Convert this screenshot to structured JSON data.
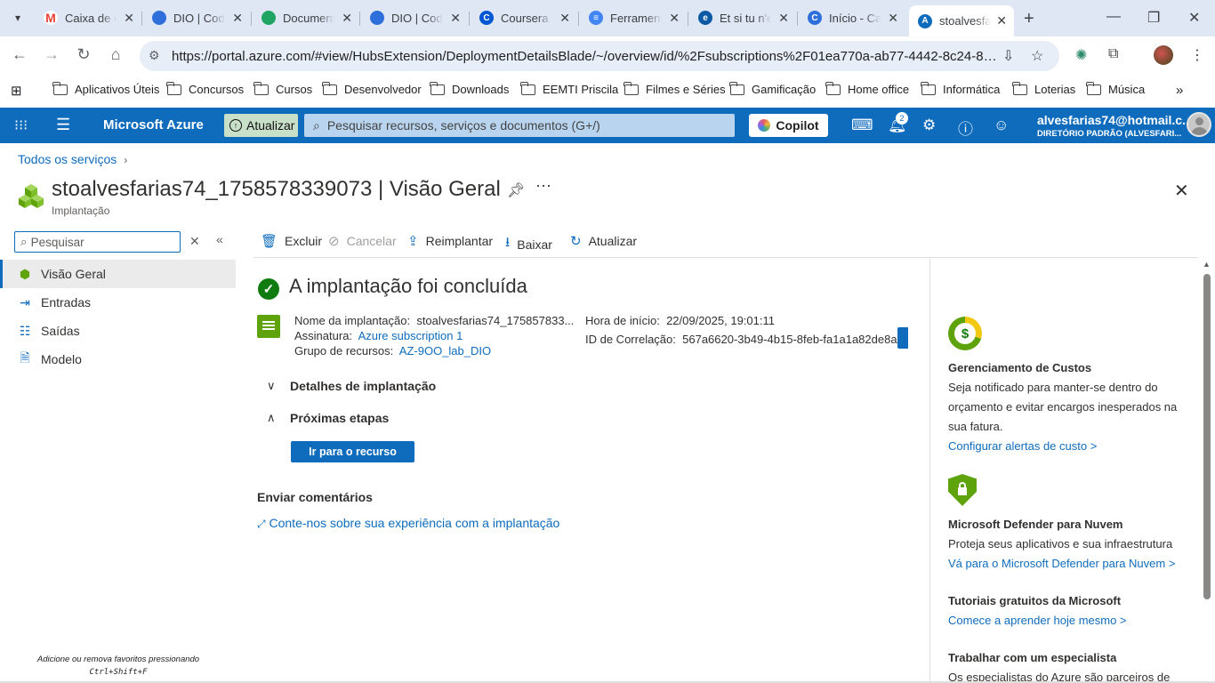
{
  "browser": {
    "tabs": [
      {
        "title": "Caixa de e",
        "icon": "gmail-icon",
        "color": "#ea4335",
        "glyph": "M"
      },
      {
        "title": "DIO | Codi",
        "icon": "dio-icon",
        "color": "#2f6fdc",
        "glyph": ""
      },
      {
        "title": "Documento",
        "icon": "google-drive-icon",
        "color": "#1fa463",
        "glyph": ""
      },
      {
        "title": "DIO | Codi",
        "icon": "dio-icon",
        "color": "#2f6fdc",
        "glyph": ""
      },
      {
        "title": "Coursera |",
        "icon": "coursera-icon",
        "color": "#0056d2",
        "glyph": "C"
      },
      {
        "title": "Ferramenta",
        "icon": "google-docs-icon",
        "color": "#4285f4",
        "glyph": "≡"
      },
      {
        "title": "Et si tu n'e",
        "icon": "edge-icon",
        "color": "#0c59a4",
        "glyph": "e"
      },
      {
        "title": "Início - Ca",
        "icon": "copilot-icon",
        "color": "#2f6fdc",
        "glyph": "C"
      },
      {
        "title": "stoalvesfa",
        "icon": "azure-icon",
        "color": "#0f6cbd",
        "glyph": "A"
      }
    ],
    "url": "https://portal.azure.com/#view/HubsExtension/DeploymentDetailsBlade/~/overview/id/%2Fsubscriptions%2F01ea770a-ab77-4442-8c24-83f786187...",
    "bookmarks": [
      "Aplicativos Úteis",
      "Concursos",
      "Cursos",
      "Desenvolvedor",
      "Downloads",
      "EEMTI Priscila",
      "Filmes e Séries",
      "Gamificação",
      "Home office",
      "Informática",
      "Loterias",
      "Música"
    ]
  },
  "azure": {
    "brand": "Microsoft Azure",
    "upgrade_label": "Atualizar",
    "search_placeholder": "Pesquisar recursos, serviços e documentos (G+/)",
    "copilot_label": "Copilot",
    "notification_count": "2",
    "account_email": "alvesfarias74@hotmail.c...",
    "account_directory": "DIRETÓRIO PADRÃO (ALVESFARI..."
  },
  "header": {
    "breadcrumb": "Todos os serviços",
    "title": "stoalvesfarias74_1758578339073 | Visão Geral",
    "subtitle": "Implantação"
  },
  "leftnav": {
    "search_placeholder": "Pesquisar",
    "items": [
      {
        "label": "Visão Geral",
        "icon": "overview-icon"
      },
      {
        "label": "Entradas",
        "icon": "inputs-icon"
      },
      {
        "label": "Saídas",
        "icon": "outputs-icon"
      },
      {
        "label": "Modelo",
        "icon": "template-icon"
      }
    ],
    "hint_line1": "Adicione ou remova favoritos pressionando",
    "hint_line2": "Ctrl+Shift+F"
  },
  "commands": {
    "delete": "Excluir",
    "cancel": "Cancelar",
    "redeploy": "Reimplantar",
    "download": "Baixar",
    "refresh": "Atualizar"
  },
  "main": {
    "status_title": "A implantação foi concluída",
    "deployment_name_label": "Nome da implantação:",
    "deployment_name_value": "stoalvesfarias74_175857833...",
    "subscription_label": "Assinatura:",
    "subscription_value": "Azure subscription 1",
    "resource_group_label": "Grupo de recursos:",
    "resource_group_value": "AZ-9OO_lab_DIO",
    "start_time_label": "Hora de início:",
    "start_time_value": "22/09/2025, 19:01:11",
    "correlation_label": "ID de Correlação:",
    "correlation_value": "567a6620-3b49-4b15-8feb-fa1a1a82de8a",
    "details_label": "Detalhes de implantação",
    "next_steps_label": "Próximas etapas",
    "goto_resource_label": "Ir para o recurso",
    "feedback_title": "Enviar comentários",
    "feedback_link": "Conte-nos sobre sua experiência com a implantação"
  },
  "rightpanel": {
    "cost_title": "Gerenciamento de Custos",
    "cost_text": "Seja notificado para manter-se dentro do orçamento e evitar encargos inesperados na sua fatura.",
    "cost_link": "Configurar alertas de custo >",
    "defender_title": "Microsoft Defender para Nuvem",
    "defender_text": "Proteja seus aplicativos e sua infraestrutura",
    "defender_link": "Vá para o Microsoft Defender para Nuvem >",
    "tutorials_title": "Tutoriais gratuitos da Microsoft",
    "tutorials_link": "Comece a aprender hoje mesmo >",
    "expert_title": "Trabalhar com um especialista",
    "expert_text": "Os especialistas do Azure são parceiros de"
  }
}
